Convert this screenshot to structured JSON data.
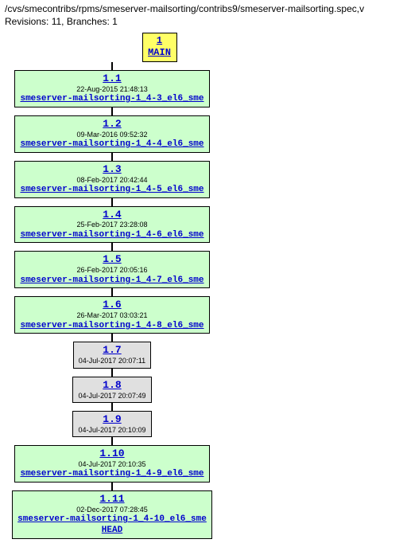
{
  "header": {
    "path": "/cvs/smecontribs/rpms/smeserver-mailsorting/contribs9/smeserver-mailsorting.spec,v",
    "stats": "Revisions: 11, Branches: 1"
  },
  "main": {
    "num": "1",
    "label": "MAIN"
  },
  "revisions": [
    {
      "num": "1.1",
      "date": "22-Aug-2015 21:48:13",
      "tag": "smeserver-mailsorting-1_4-3_el6_sme",
      "tagged": true
    },
    {
      "num": "1.2",
      "date": "09-Mar-2016 09:52:32",
      "tag": "smeserver-mailsorting-1_4-4_el6_sme",
      "tagged": true
    },
    {
      "num": "1.3",
      "date": "08-Feb-2017 20:42:44",
      "tag": "smeserver-mailsorting-1_4-5_el6_sme",
      "tagged": true
    },
    {
      "num": "1.4",
      "date": "25-Feb-2017 23:28:08",
      "tag": "smeserver-mailsorting-1_4-6_el6_sme",
      "tagged": true
    },
    {
      "num": "1.5",
      "date": "26-Feb-2017 20:05:16",
      "tag": "smeserver-mailsorting-1_4-7_el6_sme",
      "tagged": true
    },
    {
      "num": "1.6",
      "date": "26-Mar-2017 03:03:21",
      "tag": "smeserver-mailsorting-1_4-8_el6_sme",
      "tagged": true
    },
    {
      "num": "1.7",
      "date": "04-Jul-2017 20:07:11",
      "tag": "",
      "tagged": false
    },
    {
      "num": "1.8",
      "date": "04-Jul-2017 20:07:49",
      "tag": "",
      "tagged": false
    },
    {
      "num": "1.9",
      "date": "04-Jul-2017 20:10:09",
      "tag": "",
      "tagged": false
    },
    {
      "num": "1.10",
      "date": "04-Jul-2017 20:10:35",
      "tag": "smeserver-mailsorting-1_4-9_el6_sme",
      "tagged": true
    },
    {
      "num": "1.11",
      "date": "02-Dec-2017 07:28:45",
      "tag": "smeserver-mailsorting-1_4-10_el6_sme",
      "tagged": true,
      "extra": "HEAD"
    }
  ]
}
